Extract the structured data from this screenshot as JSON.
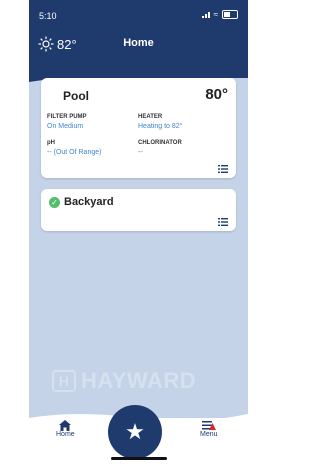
{
  "status": {
    "time": "5:10"
  },
  "header": {
    "weather_temp": "82°",
    "title": "Home",
    "icon": "sun-icon"
  },
  "pool": {
    "name": "Pool",
    "temp": "80°",
    "filter_pump_label": "FILTER PUMP",
    "filter_pump_value": "On Medium",
    "heater_label": "HEATER",
    "heater_value": "Heating to 82°",
    "ph_label": "pH",
    "ph_value": "-- (Out Of Range)",
    "chlorinator_label": "CHLORINATOR",
    "chlorinator_value": "--"
  },
  "backyard": {
    "name": "Backyard",
    "status": "check-icon"
  },
  "brand": {
    "logo_text": "HAYWARD"
  },
  "tabs": {
    "home": "Home",
    "favorites": "star-icon",
    "menu": "Menu"
  },
  "colors": {
    "navy": "#1f3b6e",
    "accent": "#3f86cf",
    "background": "#c4d3e7",
    "success": "#56bd6a",
    "alert": "#d8262d"
  }
}
